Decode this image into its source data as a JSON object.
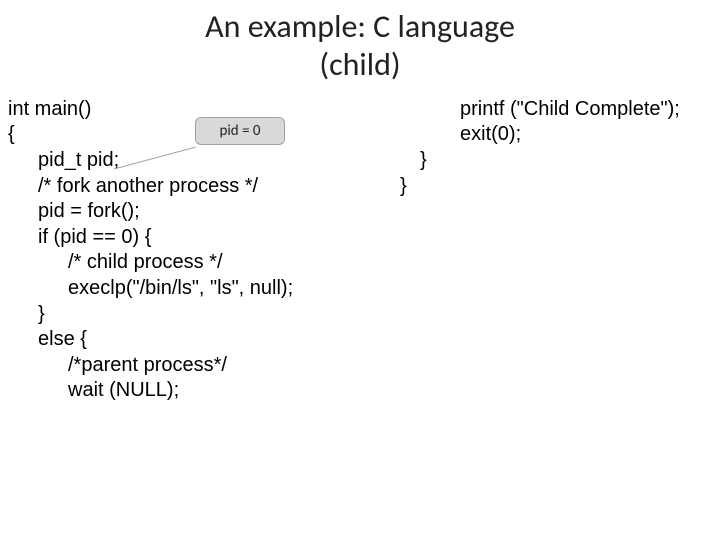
{
  "title_line1": "An example: C language",
  "title_line2": "(child)",
  "callout_label": "pid = 0",
  "left": {
    "l1": "int main()",
    "l2": "{",
    "l3": "pid_t  pid;",
    "l4": "/* fork another process */",
    "l5": "pid = fork();",
    "l6": "if (pid == 0) {",
    "l7": "/* child process */",
    "l8": "execlp(\"/bin/ls\", \"ls\", null);",
    "l9": "}",
    "l10": "else {",
    "l11": "/*parent process*/",
    "l12": "wait (NULL);"
  },
  "right": {
    "r1": "printf (\"Child Complete\");",
    "r2": "exit(0);",
    "r3": "}",
    "r4": "}"
  }
}
